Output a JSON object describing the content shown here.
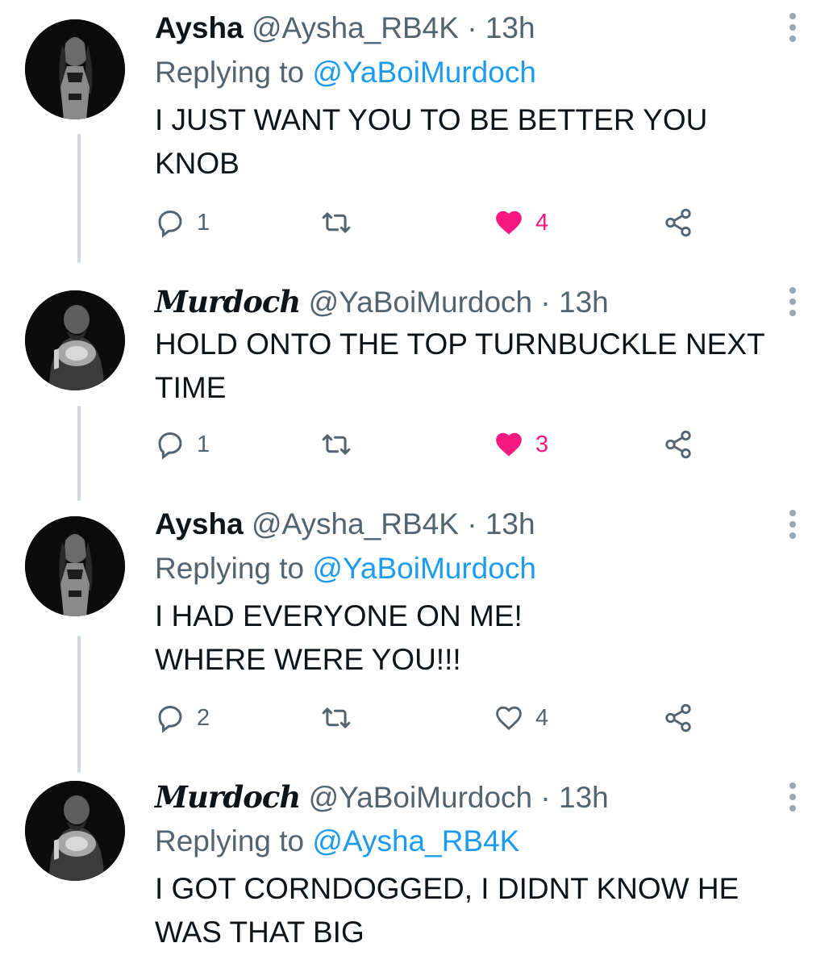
{
  "tweets": [
    {
      "author": "Aysha",
      "handle": "@Aysha_RB4K",
      "dot": "·",
      "time": "13h",
      "replying_prefix": "Replying to",
      "replying_to": "@YaBoiMurdoch",
      "text": "I JUST WANT YOU TO BE BETTER YOU\nKNOB",
      "replies": "1",
      "likes": "4",
      "liked": true
    },
    {
      "author": "Murdoch",
      "handle": "@YaBoiMurdoch",
      "dot": "·",
      "time": "13h",
      "text": "HOLD ONTO THE TOP TURNBUCKLE NEXT\nTIME",
      "replies": "1",
      "likes": "3",
      "liked": true
    },
    {
      "author": "Aysha",
      "handle": "@Aysha_RB4K",
      "dot": "·",
      "time": "13h",
      "replying_prefix": "Replying to",
      "replying_to": "@YaBoiMurdoch",
      "text": "I HAD EVERYONE ON ME!\nWHERE WERE YOU!!!",
      "replies": "2",
      "likes": "4",
      "liked": false
    },
    {
      "author": "Murdoch",
      "handle": "@YaBoiMurdoch",
      "dot": "·",
      "time": "13h",
      "replying_prefix": "Replying to",
      "replying_to": "@Aysha_RB4K",
      "text": "I GOT CORNDOGGED, I DIDNT KNOW HE\nWAS THAT BIG"
    }
  ],
  "icons": {
    "reply": "reply-icon",
    "retweet": "retweet-icon",
    "like": "heart-icon",
    "share": "share-icon",
    "more": "more-options-icon"
  },
  "colors": {
    "like_active": "#f91880",
    "mention": "#1d9bf0",
    "secondary_text": "#536471",
    "thread_line": "#cfd9de"
  }
}
